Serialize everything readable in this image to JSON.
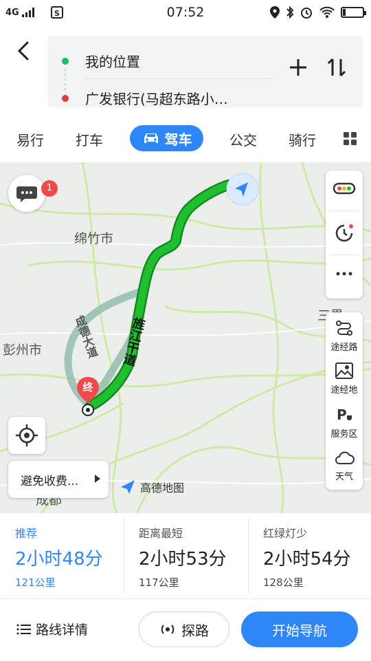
{
  "status_bar": {
    "network": "4G",
    "time": "07:52"
  },
  "route": {
    "from": "我的位置",
    "to": "广发银行(马超东路小…"
  },
  "tabs": [
    "易行",
    "打车",
    "驾车",
    "公交",
    "骑行"
  ],
  "active_tab": "驾车",
  "map": {
    "labels": {
      "mianzhu": "绵竹市",
      "pengzhou": "彭州市",
      "sanjie": "三界",
      "chengdu": "成都"
    },
    "roads": {
      "road1": "旌江干道",
      "road2": "成德大道"
    },
    "message_badge": "1",
    "end_marker": "终",
    "avoid_toll": "避免收费...",
    "logo_text": "高德地图",
    "side_tools": {
      "waypoint_road": "途经路",
      "waypoint_place": "途经地",
      "service_area": "服务区",
      "weather": "天气"
    },
    "route_color": "#1fbf2f"
  },
  "options": [
    {
      "label": "推荐",
      "time": "2小时48分",
      "distance": "121公里",
      "selected": true
    },
    {
      "label": "距离最短",
      "time": "2小时53分",
      "distance": "117公里",
      "selected": false
    },
    {
      "label": "红绿灯少",
      "time": "2小时54分",
      "distance": "128公里",
      "selected": false
    }
  ],
  "bottom": {
    "details": "路线详情",
    "probe": "探路",
    "start_nav": "开始导航"
  },
  "accent": "#2f86f6"
}
